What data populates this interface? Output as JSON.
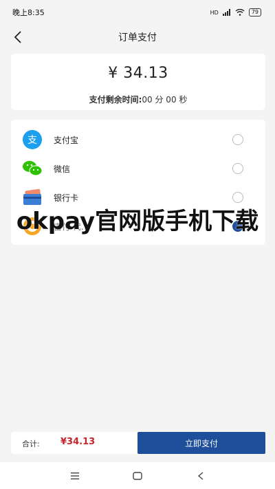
{
  "status_bar": {
    "time": "晚上8:35",
    "network": "HD",
    "battery": "79"
  },
  "nav": {
    "title": "订单支付"
  },
  "order": {
    "amount": "¥ 34.13",
    "countdown_label": "支付剩余时间:",
    "countdown_value": "00 分 00 秒"
  },
  "payment_methods": [
    {
      "label": "支付宝",
      "icon": "alipay-icon",
      "selected": false
    },
    {
      "label": "微信",
      "icon": "wechat-icon",
      "selected": false
    },
    {
      "label": "银行卡",
      "icon": "bank-card-icon",
      "selected": false
    },
    {
      "label": "吉付 代…",
      "icon": "coin-icon",
      "selected": true
    }
  ],
  "watermark": "okpay官网版手机下载",
  "footer": {
    "total_label": "合计:",
    "total_amount": "¥34.13",
    "pay_button": "立即支付"
  },
  "colors": {
    "accent": "#1f4e9a",
    "price": "#c8232c",
    "alipay": "#1d9ff0",
    "wechat": "#2dc100"
  }
}
